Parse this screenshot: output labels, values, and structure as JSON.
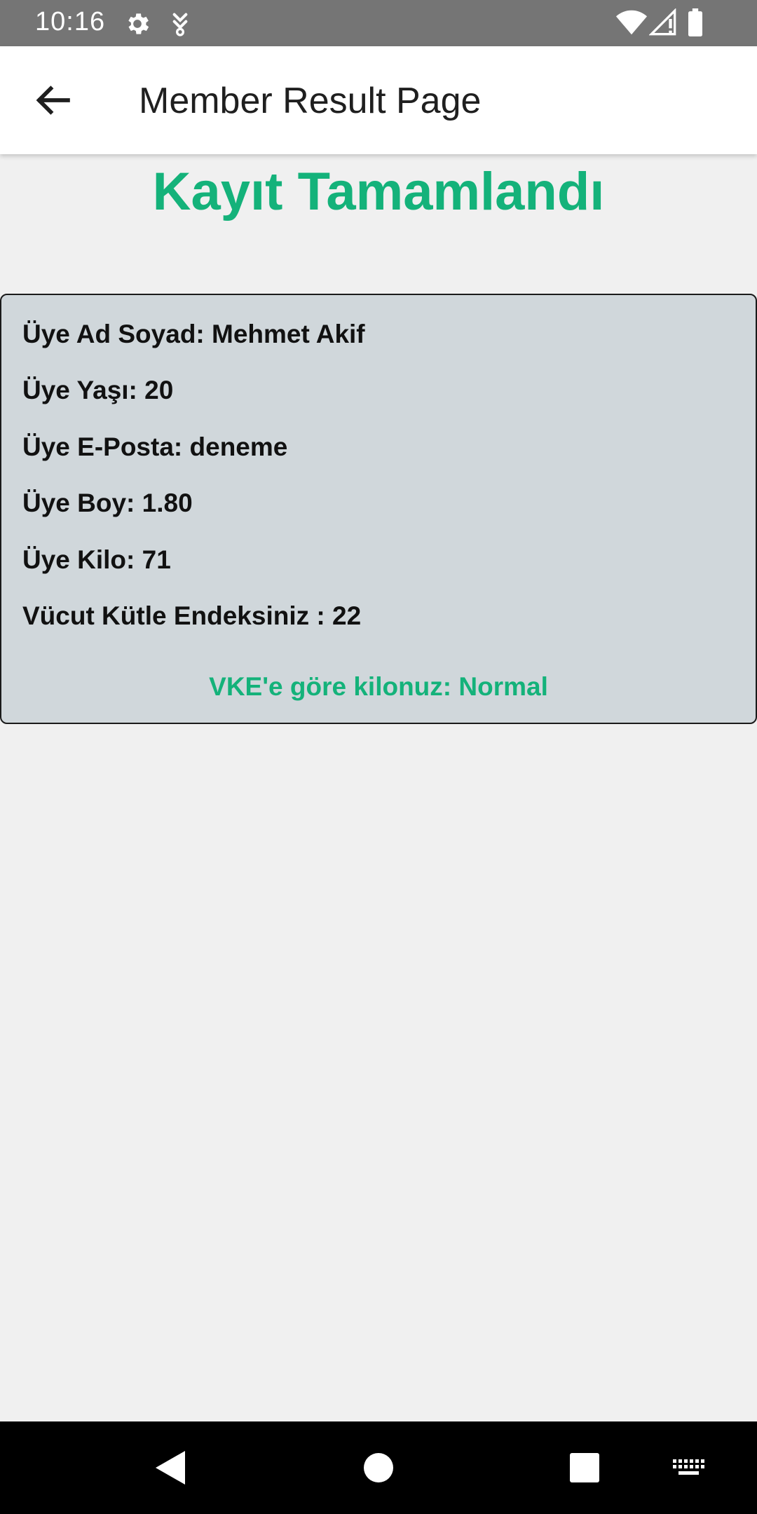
{
  "status_bar": {
    "time": "10:16",
    "icons": [
      "settings-gear-icon",
      "download-icon",
      "wifi-icon",
      "signal-icon",
      "battery-icon"
    ]
  },
  "app_bar": {
    "back_icon": "arrow-back-icon",
    "title": "Member Result Page"
  },
  "headline": "Kayıt Tamamlandı",
  "member": {
    "name": "Üye Ad Soyad: Mehmet Akif",
    "age": "Üye Yaşı: 20",
    "email": "Üye E-Posta: deneme",
    "height": "Üye Boy: 1.80",
    "weight": "Üye Kilo: 71",
    "bmi": "Vücut Kütle Endeksiniz : 22",
    "assessment": "VKE'e göre kilonuz: Normal"
  },
  "nav_bar": {
    "icons": [
      "back-triangle-icon",
      "home-circle-icon",
      "recents-square-icon",
      "keyboard-icon"
    ]
  },
  "colors": {
    "accent": "#14b27a",
    "card_background": "#d0d7db",
    "status_bar": "#757575",
    "page_background": "#f0f0f0"
  }
}
